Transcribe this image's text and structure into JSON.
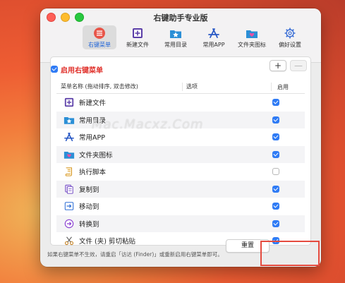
{
  "window": {
    "title": "右键助手专业版"
  },
  "toolbar": {
    "items": [
      {
        "label": "右键菜单",
        "icon": "menu-list-icon"
      },
      {
        "label": "新建文件",
        "icon": "new-file-icon"
      },
      {
        "label": "常用目录",
        "icon": "star-folder-icon"
      },
      {
        "label": "常用APP",
        "icon": "app-store-icon"
      },
      {
        "label": "文件夹图标",
        "icon": "folder-heart-icon"
      },
      {
        "label": "偏好设置",
        "icon": "gear-icon"
      }
    ]
  },
  "menu": {
    "enable_label": "启用右键菜单",
    "enabled": true,
    "add_label": "+",
    "remove_label": "—",
    "columns": {
      "name": "菜单名称 (拖动排序, 双击修改)",
      "options": "选项",
      "enabled": "启用"
    },
    "rows": [
      {
        "label": "新建文件",
        "icon": "new-file-icon",
        "enabled": true
      },
      {
        "label": "常用目录",
        "icon": "star-folder-icon",
        "enabled": true
      },
      {
        "label": "常用APP",
        "icon": "app-store-icon",
        "enabled": true
      },
      {
        "label": "文件夹图标",
        "icon": "folder-heart-icon",
        "enabled": true
      },
      {
        "label": "执行脚本",
        "icon": "script-icon",
        "enabled": false
      },
      {
        "label": "复制到",
        "icon": "copy-icon",
        "enabled": true
      },
      {
        "label": "移动到",
        "icon": "move-icon",
        "enabled": true
      },
      {
        "label": "转换到",
        "icon": "convert-icon",
        "enabled": true
      },
      {
        "label": "文件 (夹) 剪切粘贴",
        "icon": "scissors-icon",
        "enabled": true
      }
    ]
  },
  "footer": {
    "note": "如果右键菜单不生效，请重启「访达 (Finder)」或重新启用右键菜单即可。",
    "reset_label": "重置"
  },
  "watermark": "Mac.Macxz.Com",
  "colors": {
    "accent": "#2f7bf5",
    "enable_label": "#e0302a",
    "highlight_box": "#e54b3f"
  }
}
